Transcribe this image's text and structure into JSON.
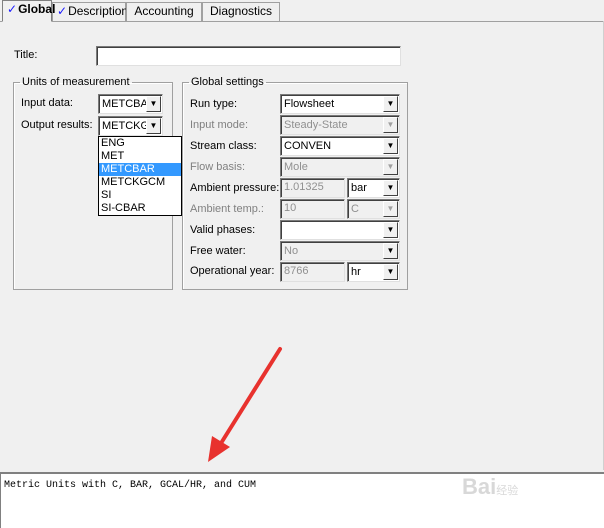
{
  "tabs": [
    {
      "label": "Global",
      "checked": true,
      "active": true
    },
    {
      "label": "Description",
      "checked": true,
      "active": false
    },
    {
      "label": "Accounting",
      "checked": false,
      "active": false
    },
    {
      "label": "Diagnostics",
      "checked": false,
      "active": false
    }
  ],
  "title_field": {
    "label": "Title:",
    "value": ""
  },
  "units": {
    "legend": "Units of measurement",
    "input_label": "Input data:",
    "input_value": "METCBA",
    "output_label": "Output results:",
    "output_value": "METCKG",
    "options": [
      "ENG",
      "MET",
      "METCBAR",
      "METCKGCM",
      "SI",
      "SI-CBAR"
    ],
    "highlighted_option": "METCBAR"
  },
  "global_settings": {
    "legend": "Global settings",
    "run_type": {
      "label": "Run type:",
      "value": "Flowsheet"
    },
    "input_mode": {
      "label": "Input mode:",
      "value": "Steady-State"
    },
    "stream_class": {
      "label": "Stream class:",
      "value": "CONVEN"
    },
    "flow_basis": {
      "label": "Flow basis:",
      "value": "Mole"
    },
    "ambient_pressure": {
      "label": "Ambient pressure:",
      "value": "1.01325",
      "unit": "bar"
    },
    "ambient_temp": {
      "label": "Ambient temp.:",
      "value": "10",
      "unit": "C"
    },
    "valid_phases": {
      "label": "Valid phases:",
      "value": ""
    },
    "free_water": {
      "label": "Free water:",
      "value": "No"
    },
    "operational_year": {
      "label": "Operational year:",
      "value": "8766",
      "unit": "hr"
    }
  },
  "description_text": "Metric Units with C, BAR, GCAL/HR, and CUM",
  "watermark": {
    "text": "Bai",
    "suffix": "经验"
  },
  "colors": {
    "highlight": "#3399ff",
    "arrow": "#e8322e",
    "check": "#1a1aff"
  }
}
